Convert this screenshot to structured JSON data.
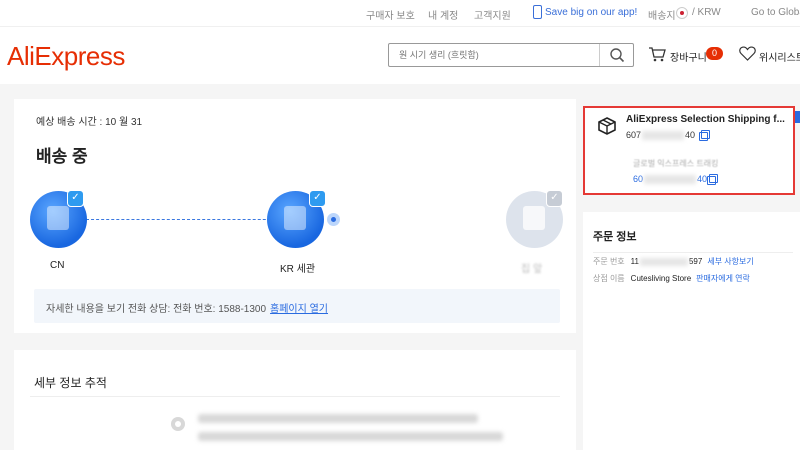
{
  "topbar": {
    "buyer_protection": "구매자 보호",
    "my_account": "내 계정",
    "customer_support": "고객지원",
    "app_promo": "Save big on our app!",
    "ship_to": "배송지",
    "currency": "/ KRW",
    "global": "Go to Global"
  },
  "header": {
    "logo": "AliExpress",
    "search_placeholder": "원 시기 생리 (흐릿함)",
    "cart_label": "장바구니",
    "cart_count": "0",
    "wishlist_label": "위시리스트"
  },
  "tracking": {
    "eta": "예상 배송 시간 : 10 월 31",
    "status_title": "배송 중",
    "nodes": [
      {
        "label": "CN"
      },
      {
        "label": "KR 세관"
      },
      {
        "label": "집 앞"
      }
    ],
    "info_text": "자세한 내용을 보기 전화 상담: 전화 번호: 1588-1300",
    "info_link": "홈페이지 열기"
  },
  "detail": {
    "title": "세부 정보 추적"
  },
  "shipping": {
    "carrier": "AliExpress Selection Shipping f...",
    "tracking_prefix": "607",
    "tracking_suffix": "40",
    "sub_label": "글로벌 익스프레스 트래킹",
    "sub_prefix": "60",
    "sub_suffix": "40"
  },
  "order": {
    "title": "주문 정보",
    "order_no_label": "주문 번호",
    "order_no_prefix": "11",
    "order_no_suffix": "597",
    "order_detail_link": "세부 사항보기",
    "store_label": "상점 이름",
    "store_name": "Cutesliving Store",
    "contact_link": "판매자에게 연락"
  },
  "colors": {
    "brand": "#e62e04",
    "accent": "#2a6be0",
    "highlight_border": "#e53935"
  }
}
